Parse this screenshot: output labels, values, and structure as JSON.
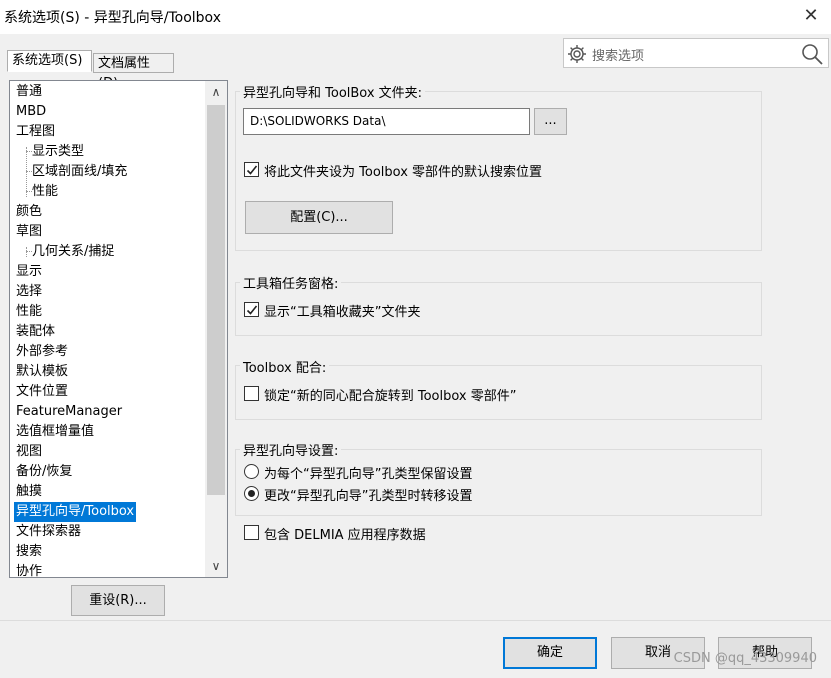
{
  "window": {
    "title": "系统选项(S) - 异型孔向导/Toolbox",
    "close_symbol": "✕"
  },
  "tabs": [
    {
      "label": "系统选项(S)",
      "active": true
    },
    {
      "label": "文档属性(D)",
      "active": false
    }
  ],
  "search": {
    "label": "搜索选项",
    "icon_left": "gear-icon",
    "icon_right": "magnifier-icon"
  },
  "tree": {
    "items": [
      {
        "label": "普通",
        "level": 0
      },
      {
        "label": "MBD",
        "level": 0
      },
      {
        "label": "工程图",
        "level": 0
      },
      {
        "label": "显示类型",
        "level": 1
      },
      {
        "label": "区域剖面线/填充",
        "level": 1
      },
      {
        "label": "性能",
        "level": 1
      },
      {
        "label": "颜色",
        "level": 0
      },
      {
        "label": "草图",
        "level": 0
      },
      {
        "label": "几何关系/捕捉",
        "level": 1
      },
      {
        "label": "显示",
        "level": 0
      },
      {
        "label": "选择",
        "level": 0
      },
      {
        "label": "性能",
        "level": 0
      },
      {
        "label": "装配体",
        "level": 0
      },
      {
        "label": "外部参考",
        "level": 0
      },
      {
        "label": "默认模板",
        "level": 0
      },
      {
        "label": "文件位置",
        "level": 0
      },
      {
        "label": "FeatureManager",
        "level": 0
      },
      {
        "label": "选值框增量值",
        "level": 0
      },
      {
        "label": "视图",
        "level": 0
      },
      {
        "label": "备份/恢复",
        "level": 0
      },
      {
        "label": "触摸",
        "level": 0
      },
      {
        "label": "异型孔向导/Toolbox",
        "level": 0,
        "selected": true
      },
      {
        "label": "文件探索器",
        "level": 0
      },
      {
        "label": "搜索",
        "level": 0
      },
      {
        "label": "协作",
        "level": 0
      }
    ],
    "scroll_up": "∧",
    "scroll_down": "∨"
  },
  "reset_button": "重设(R)...",
  "folder_group": {
    "title": "异型孔向导和 ToolBox 文件夹:",
    "path_value": "D:\\SOLIDWORKS Data\\",
    "browse_label": "...",
    "default_search_label": "将此文件夹设为 Toolbox 零部件的默认搜索位置",
    "default_search_checked": true,
    "configure_label": "配置(C)..."
  },
  "taskpane_group": {
    "title": "工具箱任务窗格:",
    "show_label": "显示“工具箱收藏夹”文件夹",
    "show_checked": true
  },
  "mate_group": {
    "title": "Toolbox 配合:",
    "lock_label": "锁定“新的同心配合旋转到 Toolbox 零部件”",
    "lock_checked": false
  },
  "hole_group": {
    "title": "异型孔向导设置:",
    "options": [
      {
        "label": "为每个“异型孔向导”孔类型保留设置",
        "selected": false
      },
      {
        "label": "更改“异型孔向导”孔类型时转移设置",
        "selected": true
      }
    ]
  },
  "delmia": {
    "label": "包含 DELMIA 应用程序数据",
    "checked": false
  },
  "footer": {
    "ok_label": "确定",
    "cancel_label": "取消",
    "help_label": "帮助",
    "watermark": "CSDN @qq_43309940"
  }
}
